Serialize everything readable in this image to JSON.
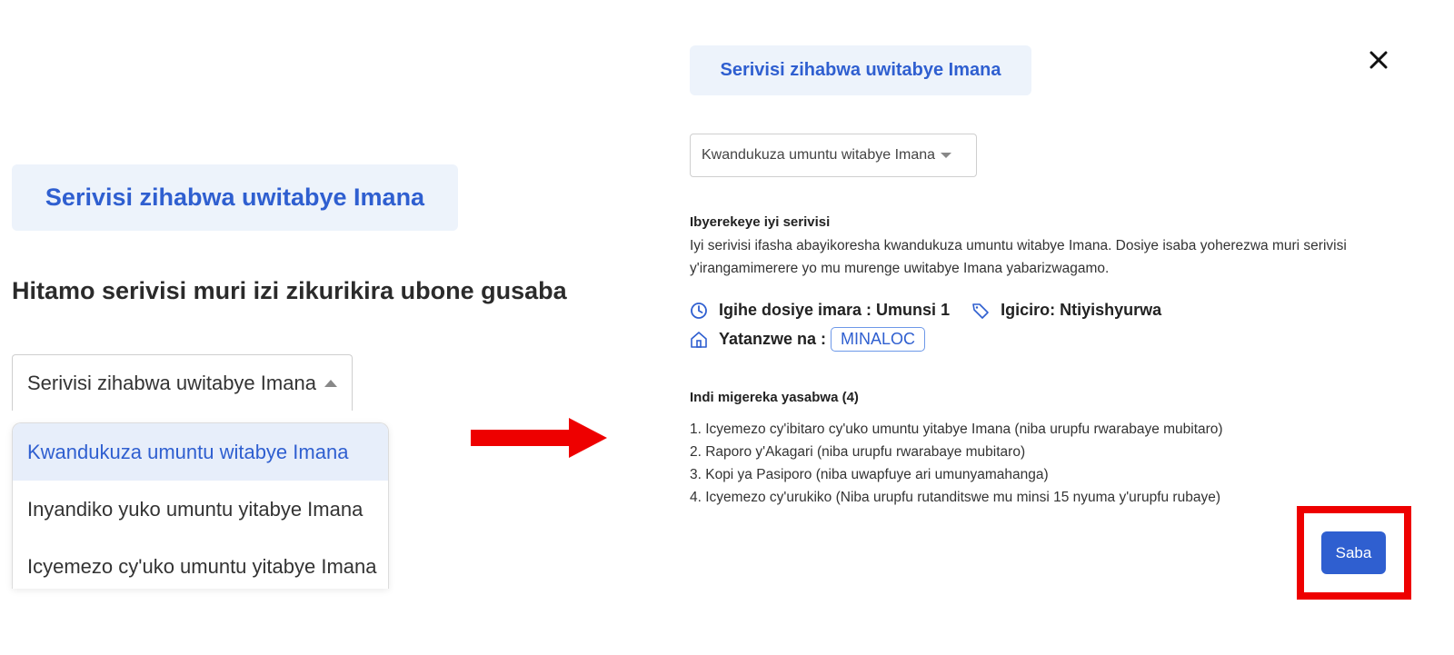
{
  "left": {
    "service_tag": "Serivisi zihabwa uwitabye Imana",
    "heading": "Hitamo serivisi muri izi zikurikira ubone gusaba",
    "select_value": "Serivisi zihabwa uwitabye Imana",
    "options": [
      "Kwandukuza umuntu witabye Imana",
      "Inyandiko yuko umuntu yitabye Imana",
      "Icyemezo cy'uko umuntu yitabye Imana"
    ]
  },
  "right": {
    "service_tag": "Serivisi zihabwa uwitabye Imana",
    "select_value": "Kwandukuza umuntu witabye Imana",
    "about_title": "Ibyerekeye iyi serivisi",
    "about_text": "Iyi serivisi ifasha abayikoresha kwandukuza umuntu witabye Imana. Dosiye isaba yoherezwa muri serivisi y'irangamimerere yo mu murenge uwitabye Imana yabarizwagamo.",
    "duration": "Igihe dosiye imara : Umunsi 1",
    "price": "Igiciro: Ntiyishyurwa",
    "provider_label": "Yatanzwe na :",
    "provider": "MINALOC",
    "docs_title": "Indi migereka yasabwa (4)",
    "documents": [
      "1. Icyemezo cy'ibitaro cy'uko umuntu yitabye Imana (niba urupfu rwarabaye mubitaro)",
      "2. Raporo y'Akagari (niba urupfu rwarabaye mubitaro)",
      "3. Kopi ya Pasiporo (niba uwapfuye ari umunyamahanga)",
      "4. Icyemezo cy'urukiko (Niba urupfu rutanditswe mu minsi 15 nyuma y'urupfu rubaye)"
    ],
    "submit_label": "Saba"
  },
  "icons": {
    "close": "close-icon",
    "clock": "clock-icon",
    "tag": "price-tag-icon",
    "building": "building-icon",
    "arrow": "arrow-right-icon"
  },
  "colors": {
    "accent": "#2f5fd0",
    "tag_bg": "#edf3fb",
    "highlight": "#ee0000",
    "arrow": "#ee0000"
  }
}
